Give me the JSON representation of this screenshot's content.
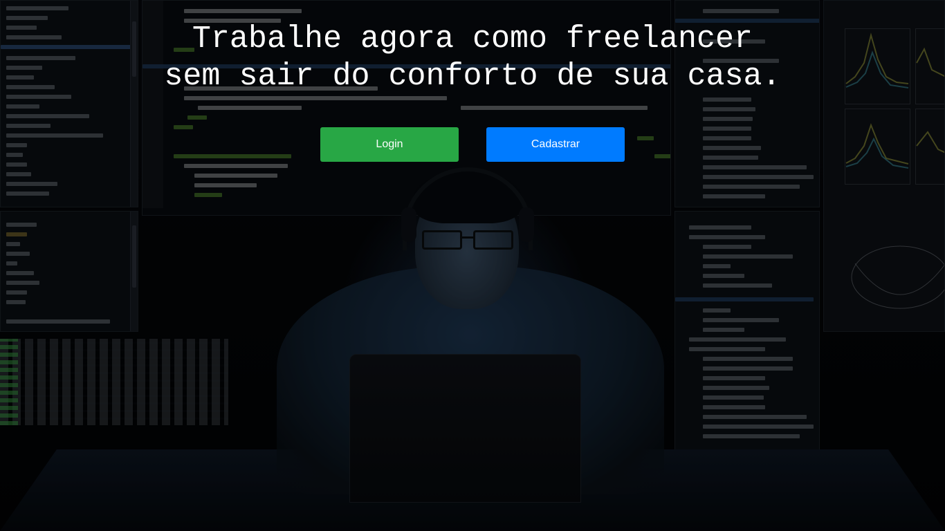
{
  "hero": {
    "headline_line1": "Trabalhe agora como freelancer",
    "headline_line2": "sem sair do conforto de sua casa.",
    "background_image": "man-with-headphones-and-laptop-in-front-of-code-screens"
  },
  "actions": {
    "login_label": "Login",
    "register_label": "Cadastrar"
  },
  "colors": {
    "login_button": "#28a745",
    "register_button": "#007bff",
    "headline_text": "#ffffff"
  }
}
